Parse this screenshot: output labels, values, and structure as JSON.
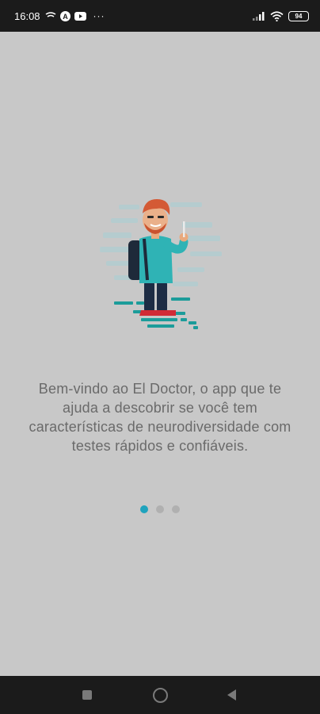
{
  "status_bar": {
    "time": "16:08",
    "left_icons": [
      "wifi-calling-icon",
      "accessibility-icon",
      "youtube-icon"
    ],
    "more": "···",
    "battery": "94"
  },
  "onboarding": {
    "welcome_text": "Bem-vindo ao El Doctor, o app que te ajuda a descobrir se você tem características de neurodiversidade com testes rápidos e confiáveis.",
    "pages": 3,
    "active_page": 1
  },
  "nav_bar": {
    "buttons": [
      "recents-icon",
      "home-icon",
      "back-icon"
    ]
  },
  "colors": {
    "background": "#c8c8c8",
    "accent": "#1fa3bd",
    "text": "#6a6a6a",
    "system_bar": "#1b1b1b"
  }
}
